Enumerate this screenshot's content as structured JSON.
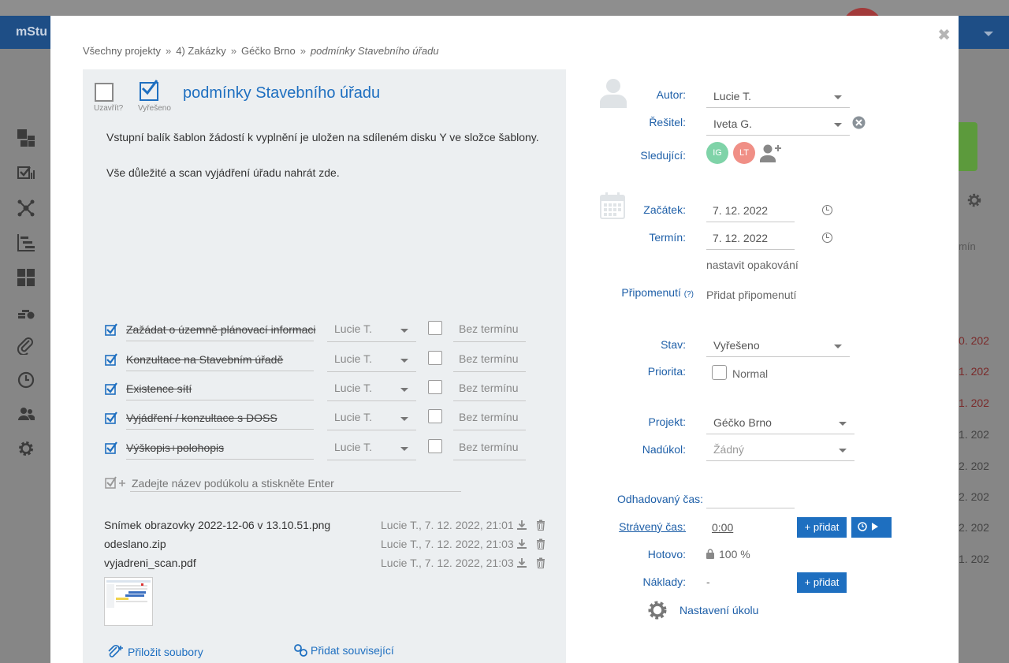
{
  "background": {
    "brand": "mStu",
    "column_header": "mín",
    "dates": [
      "0. 202",
      "1. 202",
      "1. 202",
      "1. 202",
      "2. 202",
      "2. 202",
      "2. 202",
      "1. 202"
    ]
  },
  "breadcrumb": [
    "Všechny projekty",
    "4) Zakázky",
    "Géčko Brno",
    "podmínky Stavebního úřadu"
  ],
  "breadcrumb_sep": "»",
  "task": {
    "close_label": "Uzavřít?",
    "resolved_label": "Vyřešeno",
    "title": "podmínky Stavebního úřadu",
    "description": [
      "Vstupní balík šablon žádostí k vyplnění je uložen na sdíleném disku Y ve složce šablony.",
      "Vše důležité a scan vyjádření úřadu nahrát zde."
    ]
  },
  "subtasks": [
    {
      "name": "Zažádat o územně plánovací informaci",
      "user": "Lucie T.",
      "due": "Bez termínu"
    },
    {
      "name": "Konzultace na Stavebním úřadě",
      "user": "Lucie T.",
      "due": "Bez termínu"
    },
    {
      "name": "Existence sítí",
      "user": "Lucie T.",
      "due": "Bez termínu"
    },
    {
      "name": "Vyjádření / konzultace s DOSS",
      "user": "Lucie T.",
      "due": "Bez termínu"
    },
    {
      "name": "Výškopis+polohopis",
      "user": "Lucie T.",
      "due": "Bez termínu"
    }
  ],
  "new_subtask_placeholder": "Zadejte název podúkolu a stiskněte Enter",
  "files": [
    {
      "name": "Snímek obrazovky 2022-12-06 v 13.10.51.png",
      "meta": "Lucie T., 7. 12. 2022, 21:01"
    },
    {
      "name": "odeslano.zip",
      "meta": "Lucie T., 7. 12. 2022, 21:03"
    },
    {
      "name": "vyjadreni_scan.pdf",
      "meta": "Lucie T., 7. 12. 2022, 21:03"
    }
  ],
  "footer": {
    "attach": "Přiložit soubory",
    "related": "Přidat související"
  },
  "details": {
    "author_label": "Autor:",
    "author": "Lucie T.",
    "assignee_label": "Řešitel:",
    "assignee": "Iveta G.",
    "followers_label": "Sledující:",
    "followers": [
      {
        "initials": "IG",
        "color": "#7fd3a8"
      },
      {
        "initials": "LT",
        "color": "#f08f86"
      }
    ],
    "start_label": "Začátek:",
    "start": "7. 12. 2022",
    "due_label": "Termín:",
    "due": "7. 12. 2022",
    "repeat": "nastavit opakování",
    "reminder_label": "Připomenutí",
    "reminder_help": "(?)",
    "reminder_value": "Přidat připomenutí",
    "status_label": "Stav:",
    "status": "Vyřešeno",
    "priority_label": "Priorita:",
    "priority": "Normal",
    "project_label": "Projekt:",
    "project": "Géčko Brno",
    "parent_label": "Nadúkol:",
    "parent": "Žádný",
    "estimate_label": "Odhadovaný čas:",
    "spent_label": "Strávený čas",
    "spent": "0:00",
    "add_label": "+ přidat",
    "done_label": "Hotovo:",
    "done": "100 %",
    "costs_label": "Náklady:",
    "costs": "-",
    "settings": "Nastavení úkolu"
  },
  "colors": {
    "accent": "#1e6fc0",
    "header": "#1e4e86",
    "panel": "#eceff1"
  }
}
